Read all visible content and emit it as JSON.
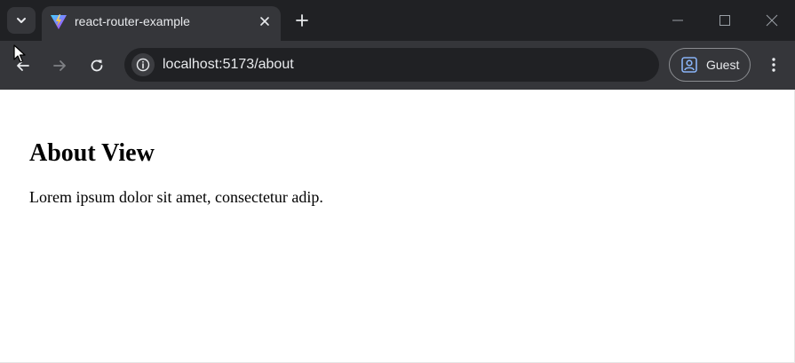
{
  "tab": {
    "title": "react-router-example",
    "favicon": "vite-logo-icon"
  },
  "address_bar": {
    "url": "localhost:5173/about"
  },
  "profile": {
    "label": "Guest"
  },
  "page": {
    "heading": "About View",
    "paragraph": "Lorem ipsum dolor sit amet, consectetur adip."
  },
  "colors": {
    "tabstrip_bg": "#202124",
    "toolbar_bg": "#35363a",
    "omnibox_bg": "#202124",
    "text_light": "#e8eaed",
    "page_bg": "#ffffff"
  }
}
